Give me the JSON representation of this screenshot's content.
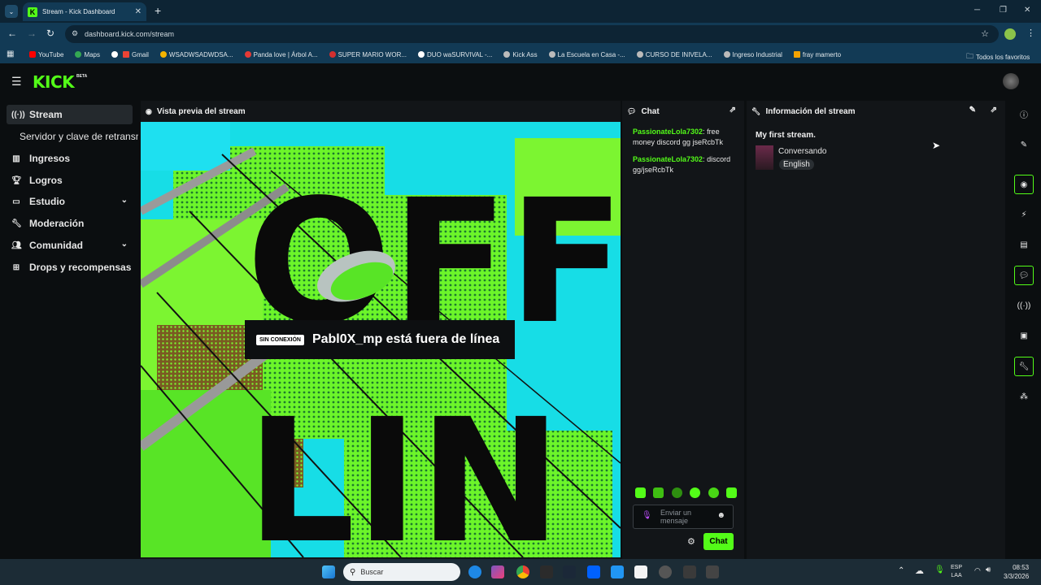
{
  "browser": {
    "tab_title": "Stream - Kick Dashboard",
    "tab_favicon": "K",
    "url": "dashboard.kick.com/stream",
    "bookmarks": [
      "YouTube",
      "Maps",
      "",
      "Gmail",
      "WSADWSADWDSA...",
      "Panda love | Árbol A...",
      "SUPER MARIO WOR...",
      "DUO waSURVIVAL -...",
      "Kick Ass",
      "La Escuela en Casa -...",
      "CURSO DE INIVELA...",
      "Ingreso Industrial",
      "fray mamerto"
    ],
    "all_bookmarks": "Todos los favoritos"
  },
  "app": {
    "logo": "KICK",
    "logo_badge": "BETA",
    "accent": "#53fc18"
  },
  "sidebar": {
    "items": [
      {
        "label": "Stream",
        "icon": "broadcast-icon",
        "active": true
      },
      {
        "label": "Servidor y clave de retransm",
        "icon": "",
        "active": false
      },
      {
        "label": "Ingresos",
        "icon": "chart-icon",
        "active": false
      },
      {
        "label": "Logros",
        "icon": "trophy-icon",
        "active": false
      },
      {
        "label": "Estudio",
        "icon": "studio-icon",
        "active": false,
        "expandable": true
      },
      {
        "label": "Moderación",
        "icon": "wrench-icon",
        "active": false
      },
      {
        "label": "Comunidad",
        "icon": "people-icon",
        "active": false,
        "expandable": true
      },
      {
        "label": "Drops y recompensas",
        "icon": "gift-icon",
        "active": false
      }
    ]
  },
  "preview": {
    "title": "Vista previa del stream",
    "offline_badge": "SIN CONEXIÓN",
    "offline_message": "Pabl0X_mp está fuera de línea",
    "bg_text_top": "OFF",
    "bg_text_bottom": "LIN"
  },
  "chat": {
    "title": "Chat",
    "messages": [
      {
        "user": "PassionateLola7302",
        "text": "free money discord gg jseRcbTk"
      },
      {
        "user": "PassionateLola7302",
        "text": "discord gg/jseRcbTk"
      }
    ],
    "input_placeholder": "Enviar un mensaje",
    "send_label": "Chat"
  },
  "info": {
    "title": "Información del stream",
    "stream_title": "My first stream.",
    "category": "Conversando",
    "language": "English"
  },
  "taskbar": {
    "search_placeholder": "Buscar",
    "lang_top": "ESP",
    "lang_bottom": "LAA",
    "time": "08:53",
    "date": "3/3/2026"
  }
}
